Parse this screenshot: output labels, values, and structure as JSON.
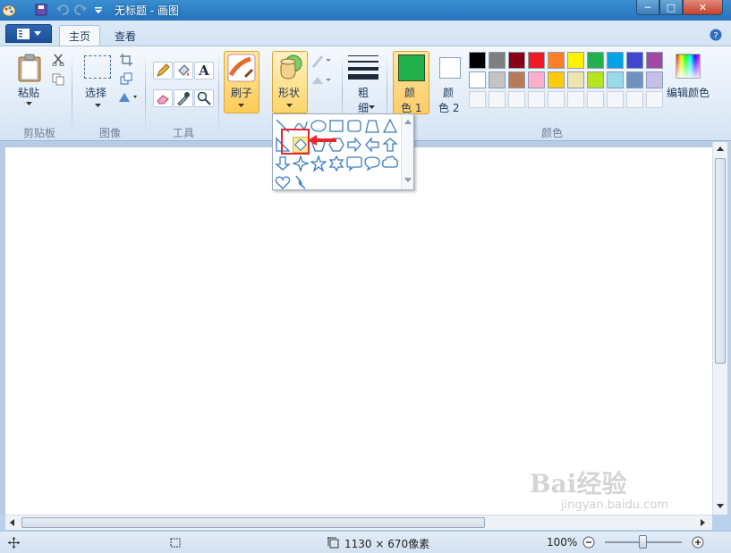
{
  "window": {
    "title": "无标题 - 画图",
    "minimize": "─",
    "maximize": "□",
    "close": "✕"
  },
  "tabs": [
    {
      "label": "主页",
      "active": true
    },
    {
      "label": "查看",
      "active": false
    }
  ],
  "ribbon": {
    "clipboard": {
      "paste_label": "粘贴",
      "group_label": "剪贴板"
    },
    "image": {
      "select_label": "选择",
      "group_label": "图像"
    },
    "tools": {
      "group_label": "工具",
      "text_tool_glyph": "A"
    },
    "brushes_label": "刷子",
    "shapes_label": "形状",
    "size_label_1": "粗",
    "size_label_2": "细",
    "color1_label_1": "颜",
    "color1_label_2": "色 1",
    "color2_label_1": "颜",
    "color2_label_2": "色 2",
    "edit_colors_label": "编辑颜色",
    "colors_group_label": "颜色"
  },
  "colors": {
    "color1": "#22b14c",
    "color2": "#ffffff",
    "palette_row1": [
      "#000000",
      "#7f7f7f",
      "#880015",
      "#ed1c24",
      "#ff7f27",
      "#fff200",
      "#22b14c",
      "#00a2e8",
      "#3f48cc",
      "#a349a4"
    ],
    "palette_row2": [
      "#ffffff",
      "#c3c3c3",
      "#b97a57",
      "#ffaec9",
      "#ffc90e",
      "#efe4b0",
      "#b5e61d",
      "#99d9ea",
      "#7092be",
      "#c8bfe7"
    ],
    "accent_red": "#e8262b"
  },
  "shapes_gallery": {
    "items": [
      "line-icon",
      "curve-icon",
      "oval-icon",
      "rectangle-icon",
      "rounded-rectangle-icon",
      "polygon-icon",
      "triangle-icon",
      "right-triangle-icon",
      "diamond-icon",
      "pentagon-icon",
      "hexagon-icon",
      "right-arrow-icon",
      "left-arrow-icon",
      "up-arrow-icon",
      "down-arrow-icon",
      "four-point-star-icon",
      "five-point-star-icon",
      "six-point-star-icon",
      "rounded-callout-icon",
      "oval-callout-icon",
      "cloud-callout-icon",
      "heart-icon",
      "lightning-icon"
    ],
    "selected": "diamond-icon"
  },
  "status": {
    "dimensions": "1130 × 670像素",
    "zoom": "100%"
  },
  "watermark": {
    "text": "Bai经验",
    "url": "jingyan.baidu.com"
  }
}
